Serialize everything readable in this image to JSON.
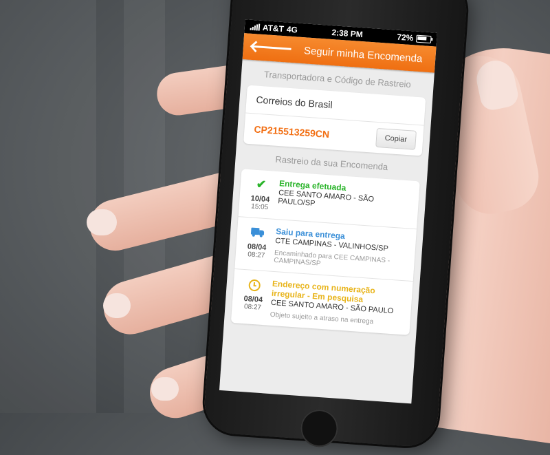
{
  "status_bar": {
    "carrier": "AT&T",
    "network": "4G",
    "time": "2:38 PM",
    "battery": "72%"
  },
  "nav": {
    "back_icon": "arrow-left-icon",
    "title": "Seguir minha Encomenda"
  },
  "carrier_section": {
    "header": "Transportadora e Código de Rastreio",
    "carrier_name": "Correios do Brasil",
    "tracking_code": "CP215513259CN",
    "copy_label": "Copiar"
  },
  "tracking_section": {
    "header": "Rastreio da sua Encomenda",
    "events": [
      {
        "icon": "check-icon",
        "color": "#2ab42a",
        "date": "10/04",
        "time": "15:05",
        "status": "Entrega efetuada",
        "location": "CEE SANTO AMARO - SÃO PAULO/SP",
        "note": ""
      },
      {
        "icon": "truck-icon",
        "color": "#3a8fd8",
        "date": "08/04",
        "time": "08:27",
        "status": "Saiu para entrega",
        "location": "CTE CAMPINAS - VALINHOS/SP",
        "note": "Encaminhado para CEE CAMPINAS - CAMPINAS/SP"
      },
      {
        "icon": "clock-icon",
        "color": "#e8b41a",
        "date": "08/04",
        "time": "08:27",
        "status": "Endereço com numeração irregular - Em pesquisa",
        "location": "CEE SANTO AMARO - SÃO PAULO",
        "note": "Objeto sujeito a atraso na entrega"
      }
    ]
  },
  "colors": {
    "accent": "#f26e12",
    "success": "#2ab42a",
    "info": "#3a8fd8",
    "warning": "#e8b41a"
  }
}
